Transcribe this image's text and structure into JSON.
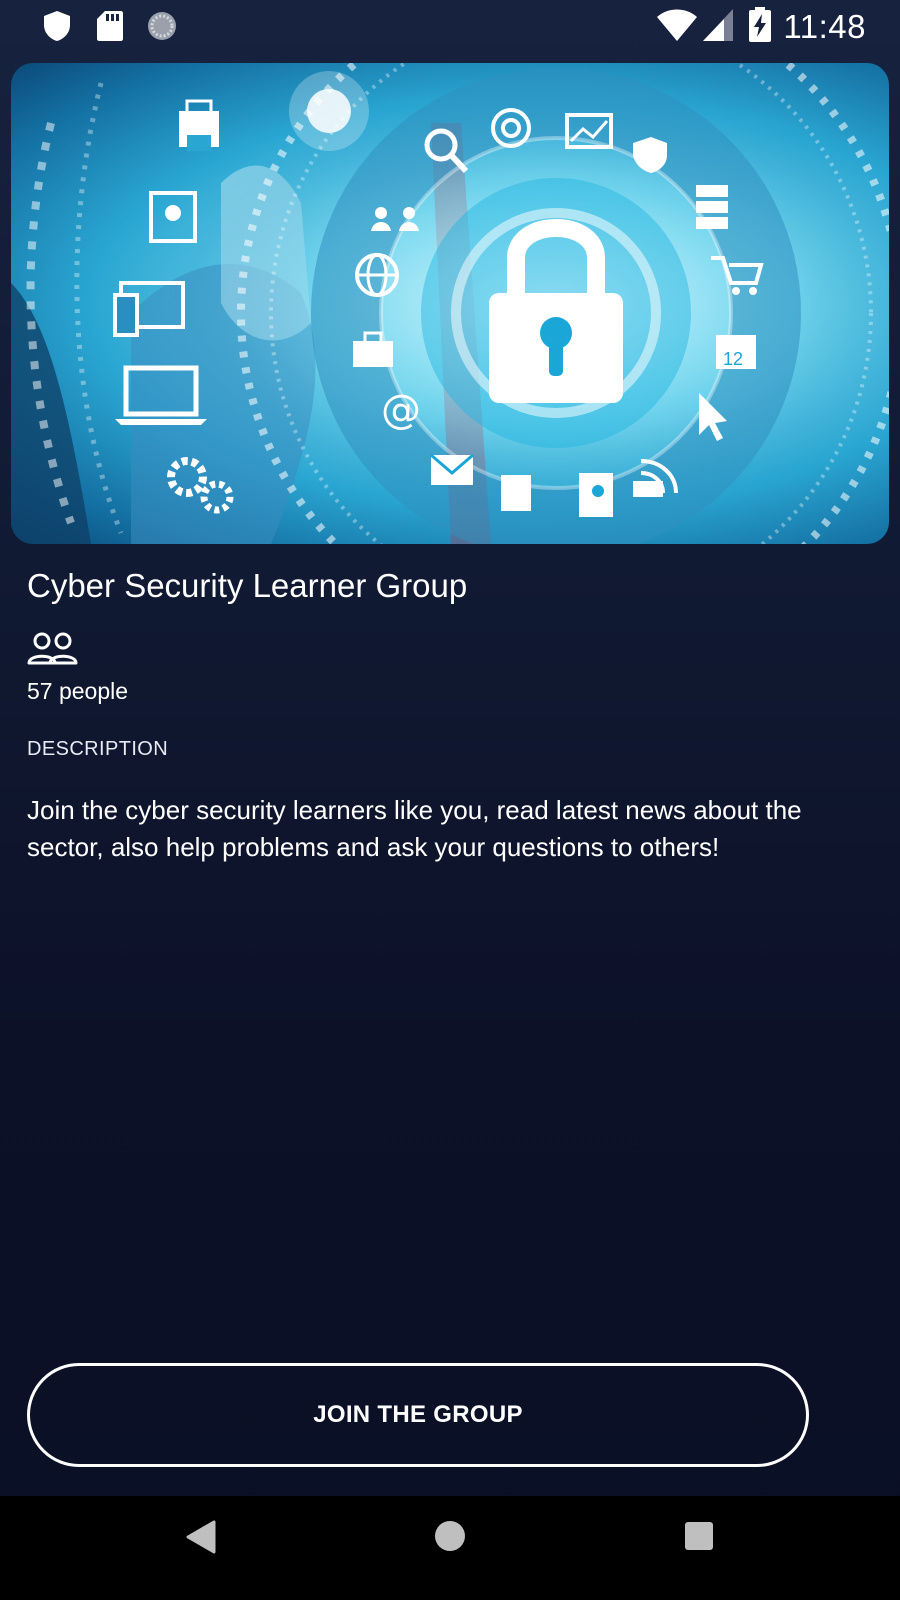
{
  "status_bar": {
    "time": "11:48",
    "left_icons": [
      "shield-icon",
      "sd-card-icon",
      "loading-spinner-icon"
    ],
    "right_icons": [
      "wifi-icon",
      "cell-signal-icon",
      "battery-charging-icon"
    ]
  },
  "group": {
    "title": "Cyber Security Learner Group",
    "members_icon": "people-icon",
    "members_count": "57 people",
    "description_label": "DESCRIPTION",
    "description": "Join the cyber security learners like you, read latest news about the sector, also help problems and ask your questions to others!",
    "hero_calendar_day": "12"
  },
  "actions": {
    "join_label": "JOIN THE GROUP"
  },
  "nav_bar": {
    "buttons": [
      "back-icon",
      "home-icon",
      "recents-icon"
    ]
  },
  "colors": {
    "background_top": "#17223f",
    "background_bottom": "#0a0f24",
    "text": "#ffffff",
    "nav_background": "#000000",
    "hero_accent": "#2aa6d2"
  }
}
